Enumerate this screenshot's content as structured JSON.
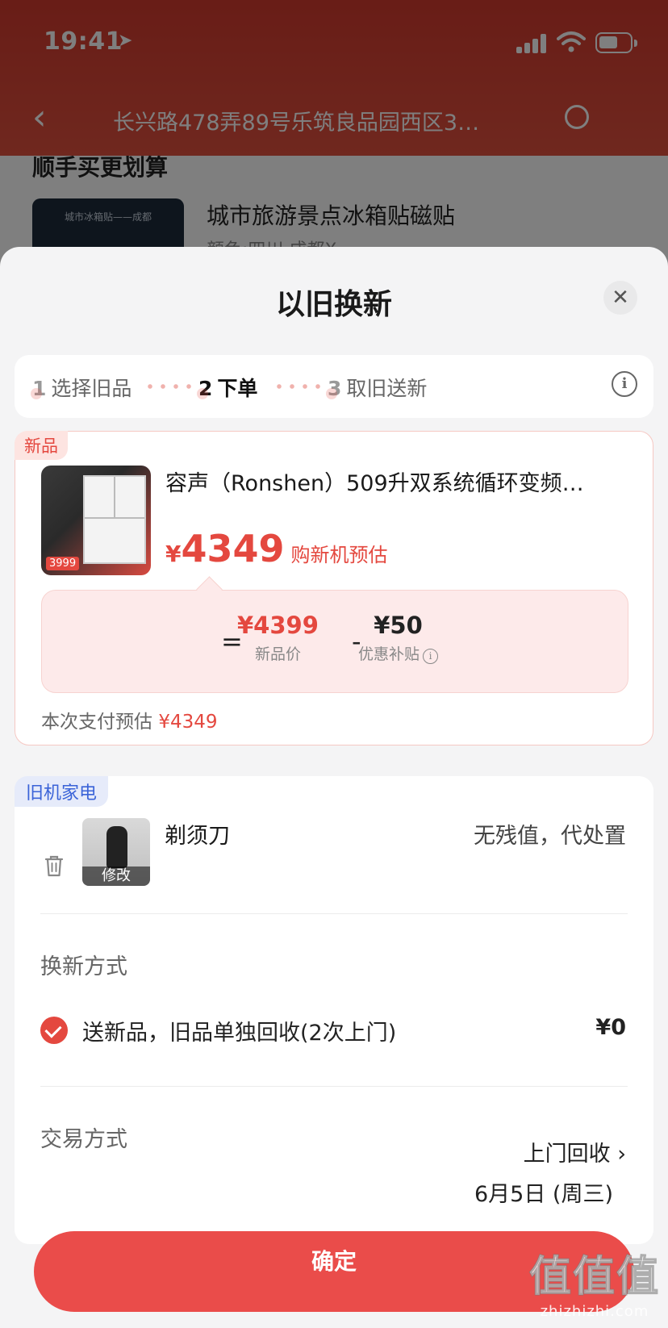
{
  "status_bar": {
    "time": "19:41",
    "location_arrow": "location-arrow-icon"
  },
  "nav": {
    "back_icon": "chevron-left-icon",
    "address": "长兴路478弄89号乐筑良品园西区3…",
    "location_icon": "location-pin-icon"
  },
  "background": {
    "section_title": "顺手买更划算",
    "product_image_text": "城市冰箱贴——成都",
    "product_name": "城市旅游景点冰箱贴磁贴",
    "product_sub": "颜色:四川 成都X"
  },
  "sheet": {
    "title": "以旧换新",
    "close_icon": "close-icon",
    "steps": [
      {
        "num": "1",
        "label": "选择旧品"
      },
      {
        "num": "2",
        "label": "下单"
      },
      {
        "num": "3",
        "label": "取旧送新"
      }
    ],
    "info_icon": "info-icon"
  },
  "new_product": {
    "tag": "新品",
    "name": "容声（Ronshen）509升双系统循环变频…",
    "image_price": "3999",
    "price_symbol": "¥",
    "price": "4349",
    "price_label": "购新机预估",
    "calc": {
      "equals": "=",
      "new_price": "¥4399",
      "new_price_label": "新品价",
      "minus": "-",
      "subsidy": "¥50",
      "subsidy_label": "优惠补贴"
    },
    "pay_label": "本次支付预估",
    "pay_amount": "¥4349"
  },
  "old_appliance": {
    "tag": "旧机家电",
    "name": "剃须刀",
    "edit_label": "修改",
    "value_text": "无残值，代处置",
    "exchange_label": "换新方式",
    "exchange_option": "送新品，旧品单独回收(2次上门)",
    "exchange_price": "¥0",
    "trade_label": "交易方式",
    "trade_method": "上门回收 ›",
    "trade_date": "6月5日 (周三)"
  },
  "confirm_label": "确定",
  "watermark": {
    "big": "值值值",
    "small": "zhizhizhi.com"
  },
  "colors": {
    "accent": "#e4483f",
    "confirm_button": "#ea4c4a",
    "old_tag": "#3a63d8"
  }
}
